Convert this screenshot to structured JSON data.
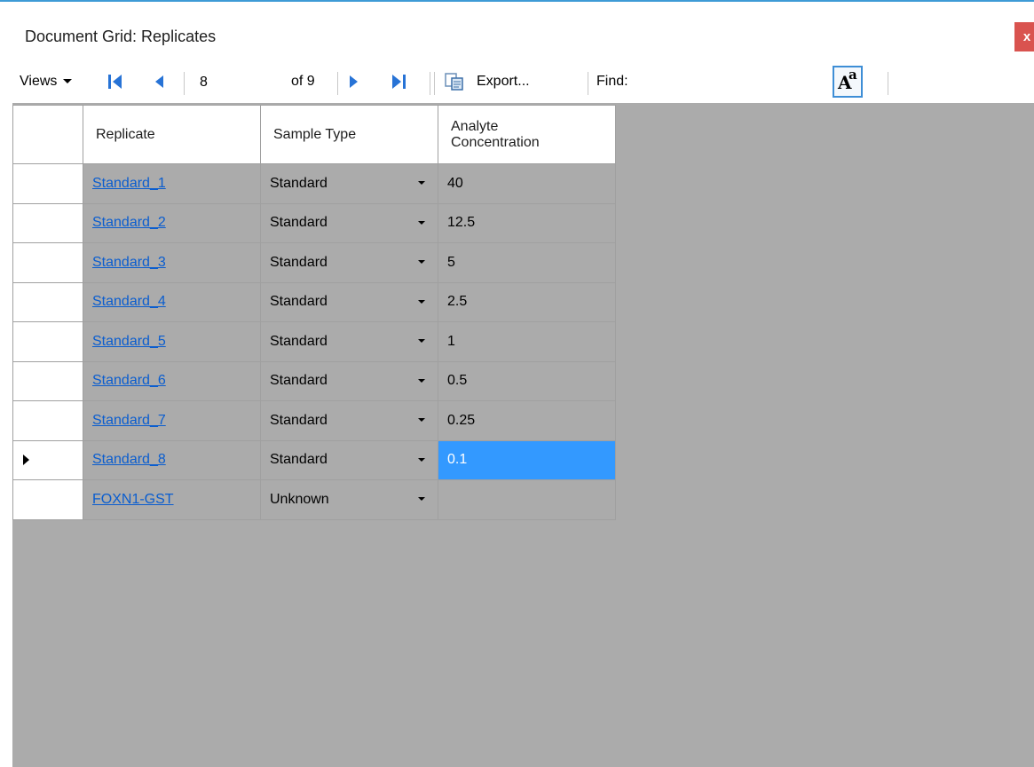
{
  "window": {
    "title": "Document Grid: Replicates",
    "close_label": "x"
  },
  "toolbar": {
    "views_label": "Views",
    "position_value": "8",
    "of_label": "of 9",
    "export_label": "Export...",
    "find_label": "Find:",
    "find_value": "",
    "font_button_big": "A",
    "font_button_small": "a"
  },
  "table": {
    "headers": [
      "",
      "Replicate",
      "Sample Type",
      "Analyte Concentration"
    ],
    "header_analyte_line1": "Analyte",
    "header_analyte_line2": "Concentration",
    "rows": [
      {
        "replicate": "Standard_1",
        "sample_type": "Standard",
        "concentration": "40"
      },
      {
        "replicate": "Standard_2",
        "sample_type": "Standard",
        "concentration": "12.5"
      },
      {
        "replicate": "Standard_3",
        "sample_type": "Standard",
        "concentration": "5"
      },
      {
        "replicate": "Standard_4",
        "sample_type": "Standard",
        "concentration": "2.5"
      },
      {
        "replicate": "Standard_5",
        "sample_type": "Standard",
        "concentration": "1"
      },
      {
        "replicate": "Standard_6",
        "sample_type": "Standard",
        "concentration": "0.5"
      },
      {
        "replicate": "Standard_7",
        "sample_type": "Standard",
        "concentration": "0.25"
      },
      {
        "replicate": "Standard_8",
        "sample_type": "Standard",
        "concentration": "0.1"
      },
      {
        "replicate": "FOXN1-GST",
        "sample_type": "Unknown",
        "concentration": ""
      }
    ],
    "current_row": 7
  },
  "colors": {
    "accent": "#3e9bd6",
    "selection": "#3399ff",
    "link": "#0a5dcf",
    "empty_area": "#ababab"
  }
}
